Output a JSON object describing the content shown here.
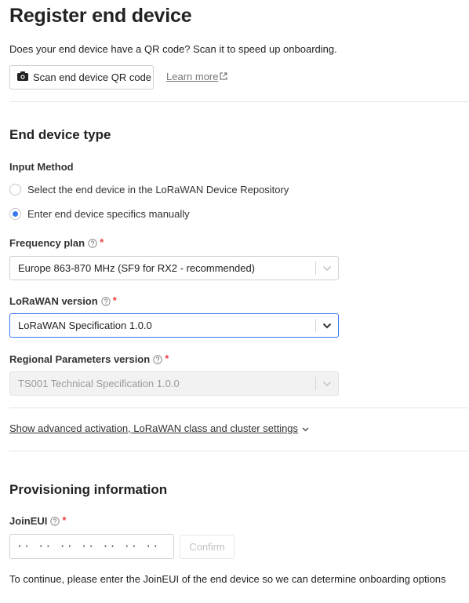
{
  "header": {
    "title": "Register end device",
    "intro": "Does your end device have a QR code? Scan it to speed up onboarding.",
    "scan_button": "Scan end device QR code",
    "learn_more": "Learn more"
  },
  "end_device_type": {
    "title": "End device type",
    "input_method": {
      "label": "Input Method",
      "options": [
        {
          "label": "Select the end device in the LoRaWAN Device Repository",
          "selected": false
        },
        {
          "label": "Enter end device specifics manually",
          "selected": true
        }
      ]
    },
    "frequency_plan": {
      "label": "Frequency plan",
      "required": "*",
      "value": "Europe 863-870 MHz (SF9 for RX2 - recommended)"
    },
    "lorawan_version": {
      "label": "LoRaWAN version",
      "required": "*",
      "value": "LoRaWAN Specification 1.0.0"
    },
    "regional_parameters": {
      "label": "Regional Parameters version",
      "required": "*",
      "value": "TS001 Technical Specification 1.0.0",
      "disabled": true
    },
    "advanced_link": "Show advanced activation, LoRaWAN class and cluster settings"
  },
  "provisioning": {
    "title": "Provisioning information",
    "joineui": {
      "label": "JoinEUI",
      "required": "*",
      "placeholder": "·· ·· ·· ·· ·· ·· ·· ··",
      "value": ""
    },
    "confirm_button": "Confirm",
    "hint": "To continue, please enter the JoinEUI of the end device so we can determine onboarding options"
  },
  "colors": {
    "accent": "#3a78f2",
    "required": "#e8413e",
    "text": "#222222"
  }
}
